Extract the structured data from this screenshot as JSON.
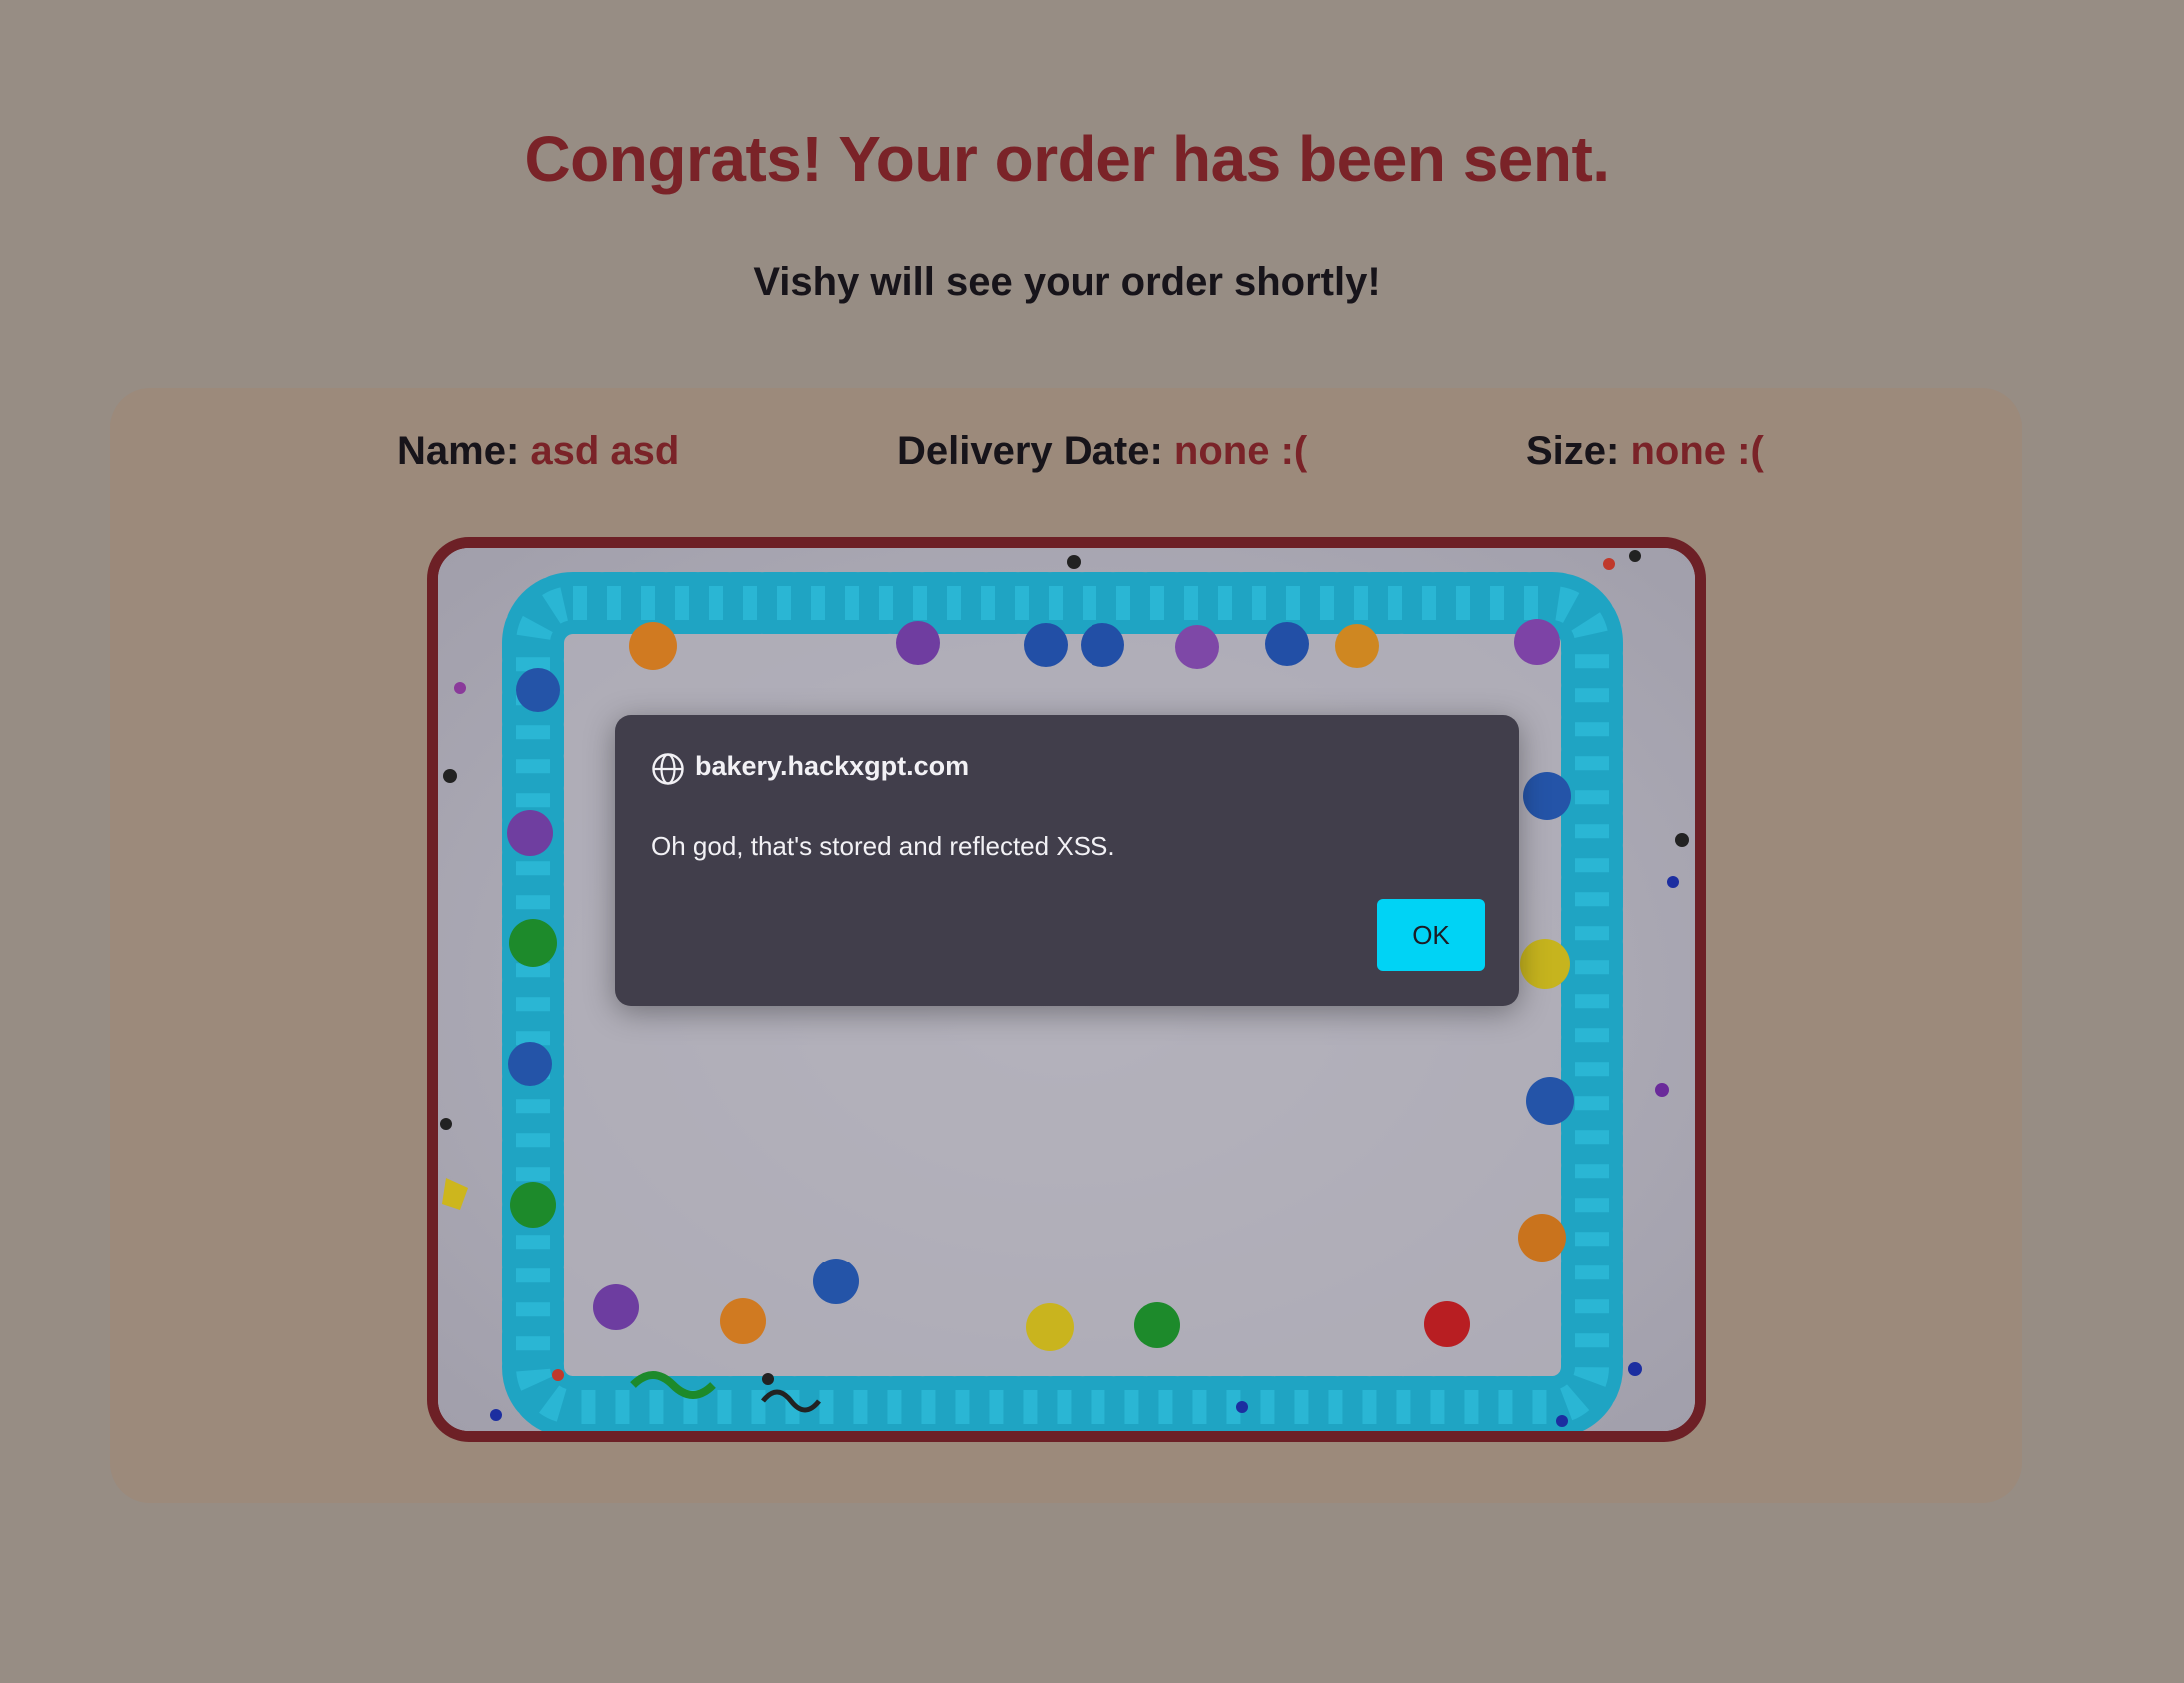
{
  "header": {
    "title": "Congrats! Your order has been sent.",
    "subtitle": "Vishy will see your order shortly!"
  },
  "order": {
    "name_label": "Name:",
    "name_value": "asd asd",
    "date_label": "Delivery Date:",
    "date_value": "none :(",
    "size_label": "Size:",
    "size_value": "none :("
  },
  "dialog": {
    "origin": "bakery.hackxgpt.com",
    "message": "Oh god, that's stored and reflected XSS.",
    "ok_label": "OK",
    "icon": "globe-icon"
  },
  "colors": {
    "accent": "#7a2328",
    "button": "#00d3f5",
    "dialog_bg": "#413e4b"
  }
}
